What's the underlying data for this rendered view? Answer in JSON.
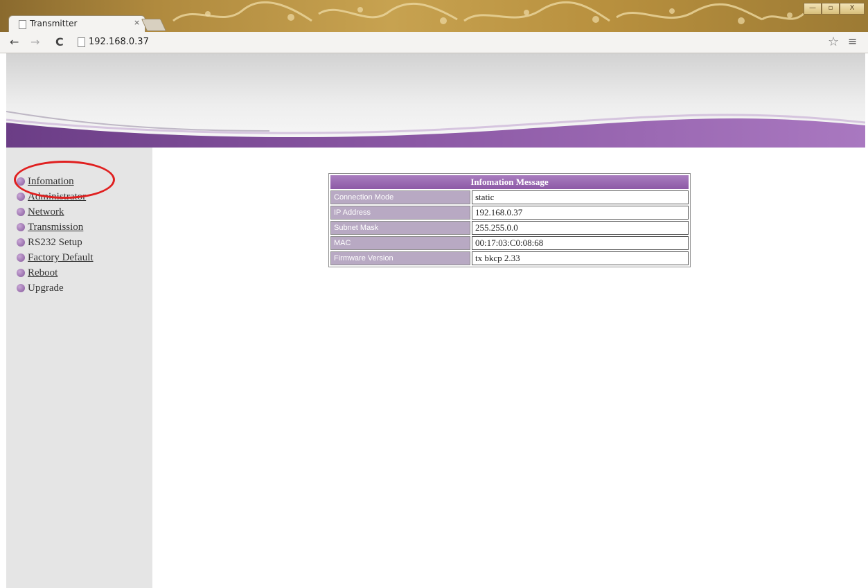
{
  "browser": {
    "tab_title": "Transmitter",
    "tab_close": "×",
    "url": "192.168.0.37",
    "back": "←",
    "forward": "→",
    "reload": "C",
    "bookmark": "☆",
    "menu": "≡",
    "minimize": "—",
    "maximize": "▫",
    "close": "X"
  },
  "sidebar": {
    "items": [
      {
        "label": "Infomation"
      },
      {
        "label": "Administrator"
      },
      {
        "label": "Network"
      },
      {
        "label": "Transmission"
      },
      {
        "label": "RS232 Setup"
      },
      {
        "label": "Factory Default"
      },
      {
        "label": "Reboot"
      },
      {
        "label": "Upgrade"
      }
    ]
  },
  "info": {
    "title": "Infomation Message",
    "rows": [
      {
        "label": "Connection Mode",
        "value": "static"
      },
      {
        "label": "IP Address",
        "value": "192.168.0.37"
      },
      {
        "label": "Subnet Mask",
        "value": "255.255.0.0"
      },
      {
        "label": "MAC",
        "value": "00:17:03:C0:08:68"
      },
      {
        "label": "Firmware Version",
        "value": "tx bkcp 2.33"
      }
    ]
  },
  "colors": {
    "accent_purple": "#8d5aa6",
    "highlight_red": "#e02020",
    "sidebar_bg": "#e5e5e5"
  }
}
